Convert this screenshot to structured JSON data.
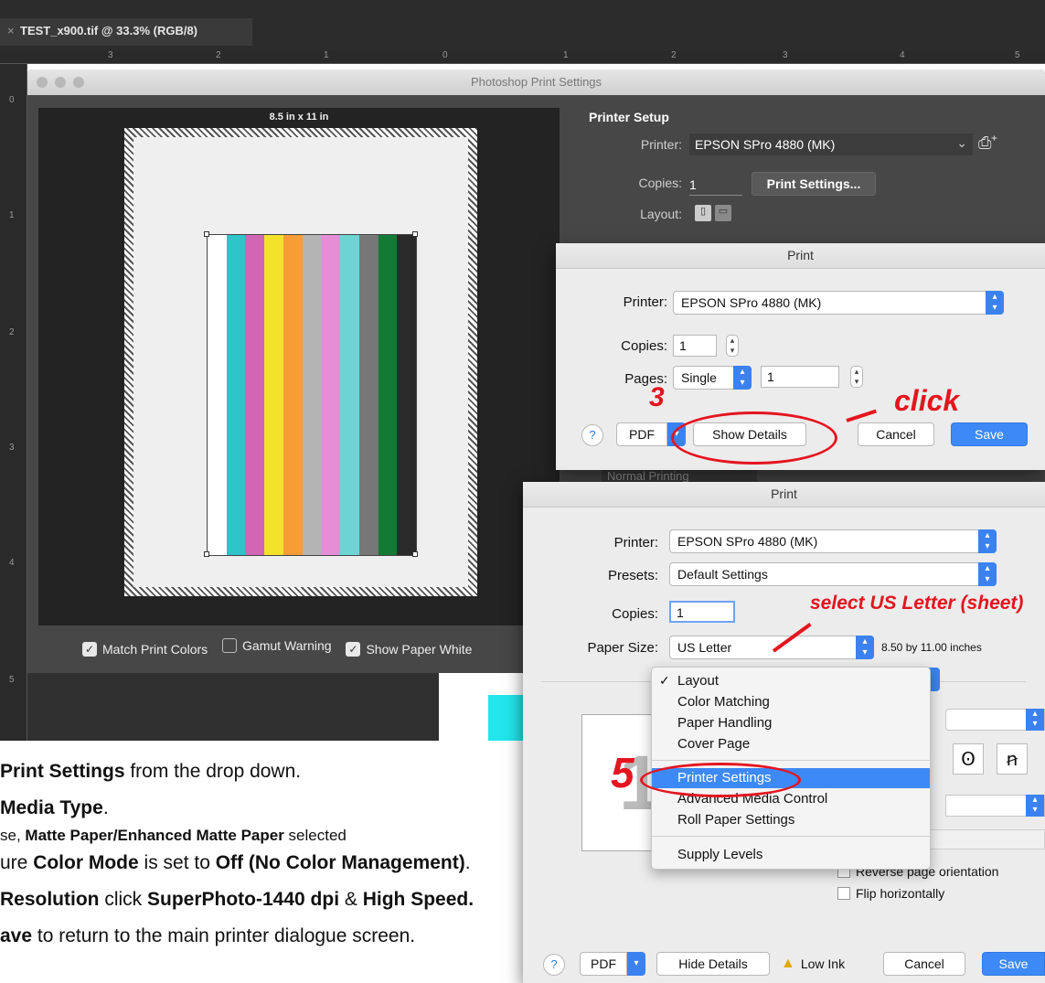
{
  "document_tab": {
    "title": "TEST_x900.tif @ 33.3% (RGB/8)",
    "close_glyph": "×"
  },
  "ruler": {
    "h_ticks": [
      "3",
      "2",
      "1",
      "0",
      "1",
      "2",
      "3",
      "4",
      "5"
    ],
    "v_ticks": [
      "0",
      "1",
      "2",
      "3",
      "4",
      "5"
    ]
  },
  "ps_dialog": {
    "title": "Photoshop Print Settings",
    "paper_size_label": "8.5 in x 11 in",
    "printer_setup": {
      "heading": "Printer Setup",
      "printer_label": "Printer:",
      "printer_value": "EPSON SPro 4880 (MK)",
      "copies_label": "Copies:",
      "copies_value": "1",
      "print_settings_button": "Print Settings...",
      "layout_label": "Layout:",
      "normal_printing": "Normal Printing"
    },
    "checkboxes": [
      {
        "label": "Match Print Colors",
        "checked": true
      },
      {
        "label": "Gamut Warning",
        "checked": false
      },
      {
        "label": "Show Paper White",
        "checked": true
      }
    ],
    "preview_bar_colors": [
      "#ffffff",
      "#2ec4c8",
      "#d166b4",
      "#f2e22a",
      "#f89c37",
      "#b4b4b4",
      "#e58ed6",
      "#6ed3d3",
      "#777777",
      "#137a35",
      "#2a2a2a"
    ]
  },
  "print_dialog_small": {
    "title": "Print",
    "printer_label": "Printer:",
    "printer_value": "EPSON SPro 4880 (MK)",
    "copies_label": "Copies:",
    "copies_value": "1",
    "pages_label": "Pages:",
    "pages_mode": "Single",
    "pages_value": "1",
    "help": "?",
    "pdf": "PDF",
    "show_details": "Show Details",
    "cancel": "Cancel",
    "save": "Save"
  },
  "print_dialog_large": {
    "title": "Print",
    "printer_label": "Printer:",
    "printer_value": "EPSON SPro 4880 (MK)",
    "presets_label": "Presets:",
    "presets_value": "Default Settings",
    "copies_label": "Copies:",
    "copies_value": "1",
    "paper_size_label": "Paper Size:",
    "paper_size_value": "US Letter",
    "paper_dimensions": "8.50 by 11.00 inches",
    "menu_items": [
      "Layout",
      "Color Matching",
      "Paper Handling",
      "Cover Page",
      "Printer Settings",
      "Advanced Media Control",
      "Roll Paper Settings",
      "Supply Levels"
    ],
    "menu_checked": "✓",
    "reverse_orientation": "Reverse page orientation",
    "flip_horizontally": "Flip horizontally",
    "preview_number": "1",
    "help": "?",
    "pdf": "PDF",
    "hide_details": "Hide Details",
    "low_ink": "Low Ink",
    "cancel": "Cancel",
    "save": "Save"
  },
  "annotations": {
    "step3": "3",
    "click": "click",
    "step5": "5",
    "select_us_letter": "select US Letter (sheet)"
  },
  "instructions": {
    "line1_bold": "Print Settings",
    "line1_rest": " from the drop down.",
    "line2_bold": "Media Type",
    "line2_rest": ".",
    "line3_pre": "se, ",
    "line3_bold": "Matte Paper/Enhanced Matte Paper",
    "line3_rest": " selected",
    "line4_pre": "ure ",
    "line4_bold1": "Color Mode",
    "line4_mid": " is set to ",
    "line4_bold2": "Off (No Color Management)",
    "line4_rest": ".",
    "line5_bold1": "Resolution",
    "line5_mid": " click ",
    "line5_bold2": "SuperPhoto-1440 dpi",
    "line5_amp": " & ",
    "line5_bold3": "High Speed.",
    "line6_bold": "ave",
    "line6_rest": " to return to the main printer dialogue screen."
  },
  "colors": {
    "accent_blue": "#3d8af7",
    "annotation_red": "#e4151f",
    "ps_dark": "#474747"
  }
}
